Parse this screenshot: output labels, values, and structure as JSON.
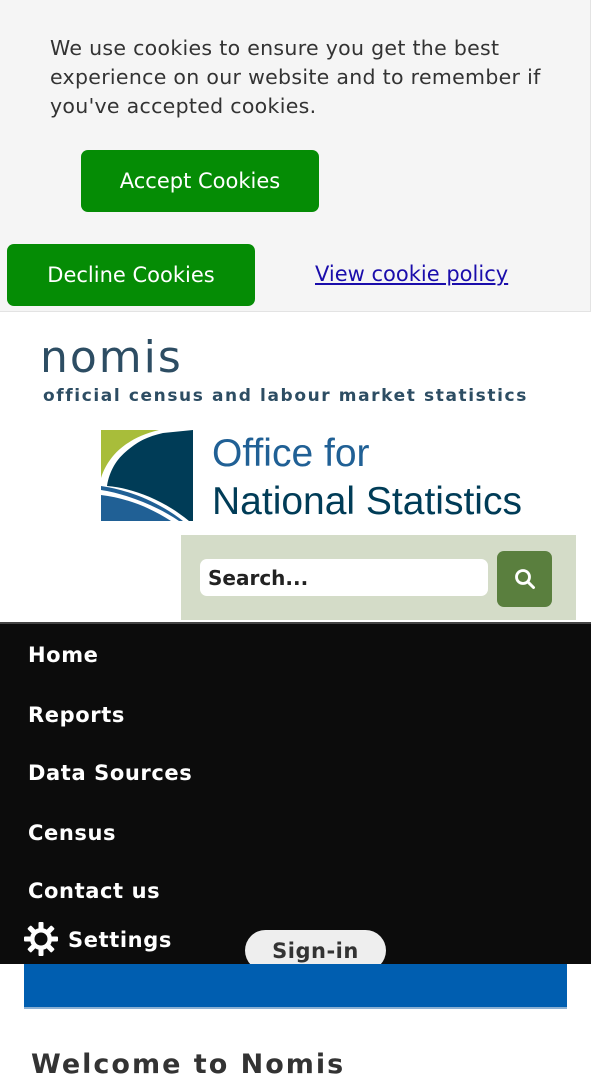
{
  "cookie_banner": {
    "message": "We use cookies to ensure you get the best experience on our website and to remember if you've accepted cookies.",
    "accept_label": "Accept Cookies",
    "decline_label": "Decline Cookies",
    "policy_link": "View cookie policy"
  },
  "header": {
    "title": "nomis",
    "subtitle": "official census and labour market statistics",
    "ons_line1": "Office for",
    "ons_line2": "National Statistics"
  },
  "search": {
    "placeholder": "Search...",
    "icon": "search-icon"
  },
  "nav": {
    "items": [
      {
        "label": "Home"
      },
      {
        "label": "Reports"
      },
      {
        "label": "Data Sources"
      },
      {
        "label": "Census"
      },
      {
        "label": "Contact us"
      }
    ],
    "settings_label": "Settings",
    "settings_icon": "gear-icon",
    "signin_label": "Sign-in"
  },
  "main": {
    "heading": "Welcome to Nomis"
  },
  "colors": {
    "button_green": "#058c05",
    "nomis_blue": "#2d4d63",
    "nav_bg": "#0c0c0c",
    "search_btn": "#5a7f3e",
    "accent_blue": "#005eb0"
  }
}
